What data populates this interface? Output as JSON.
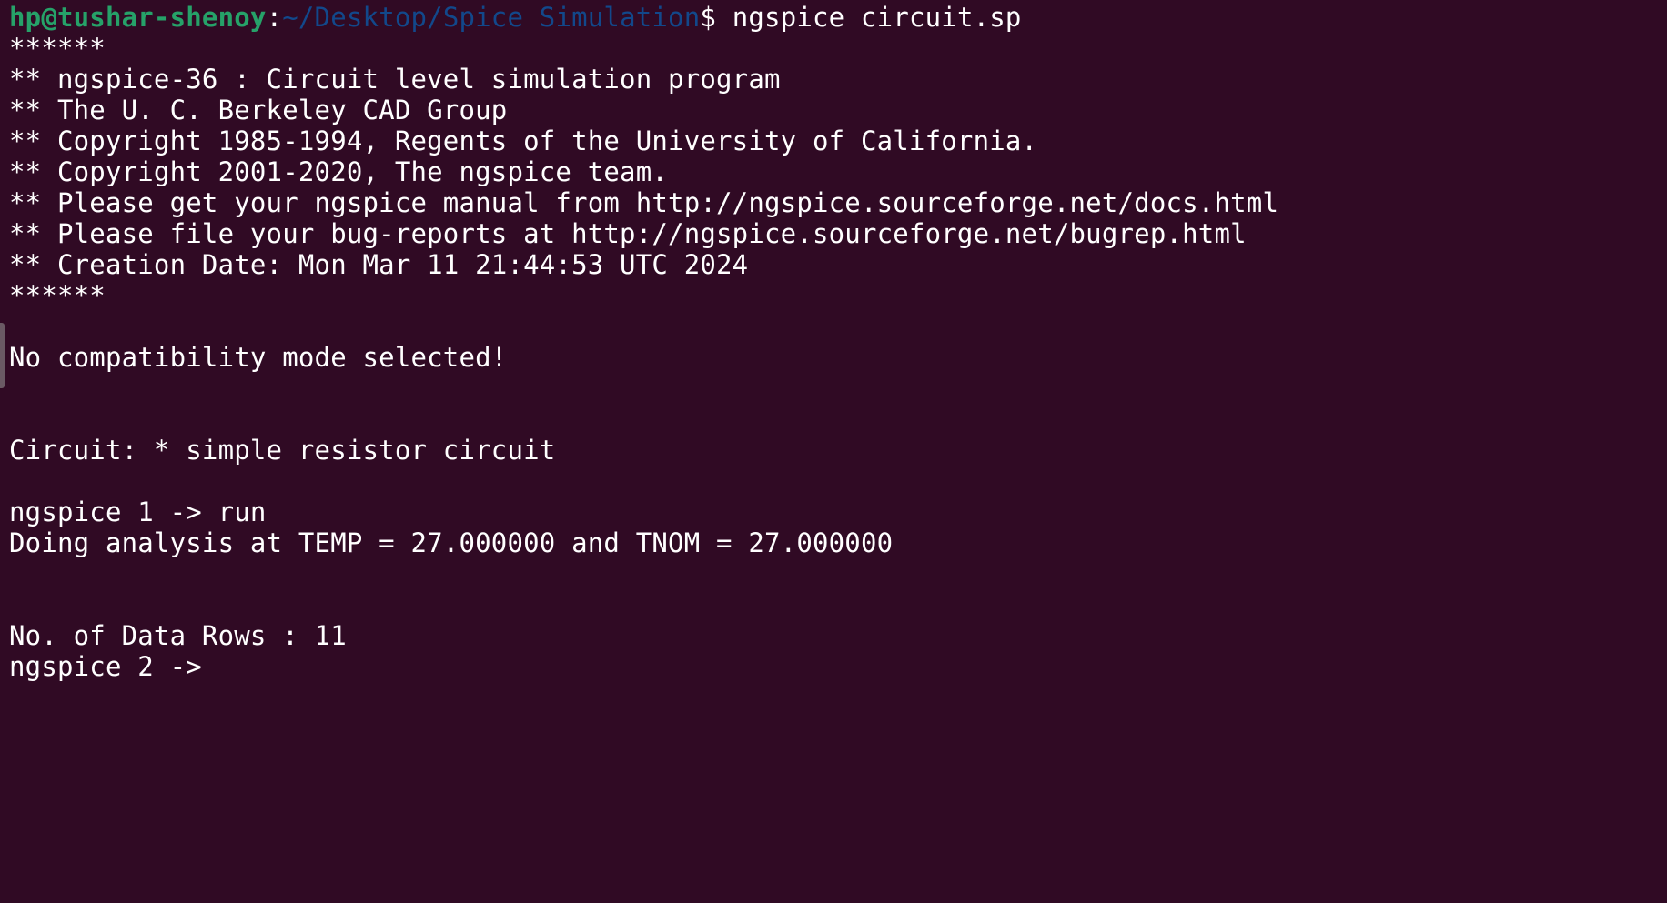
{
  "prompt": {
    "user_host": "hp@tushar-shenoy",
    "separator": ":",
    "path": "~/Desktop/Spice Simulation",
    "dollar": "$",
    "command": " ngspice circuit.sp"
  },
  "lines": [
    "******",
    "** ngspice-36 : Circuit level simulation program",
    "** The U. C. Berkeley CAD Group",
    "** Copyright 1985-1994, Regents of the University of California.",
    "** Copyright 2001-2020, The ngspice team.",
    "** Please get your ngspice manual from http://ngspice.sourceforge.net/docs.html",
    "** Please file your bug-reports at http://ngspice.sourceforge.net/bugrep.html",
    "** Creation Date: Mon Mar 11 21:44:53 UTC 2024",
    "******",
    "",
    "No compatibility mode selected!",
    "",
    "",
    "Circuit: * simple resistor circuit",
    "",
    "ngspice 1 -> run",
    "Doing analysis at TEMP = 27.000000 and TNOM = 27.000000",
    "",
    "",
    "No. of Data Rows : 11",
    "ngspice 2 -> "
  ],
  "colors": {
    "background": "#300a24",
    "text": "#ffffff",
    "user_host": "#26a269",
    "path": "#12488b"
  }
}
